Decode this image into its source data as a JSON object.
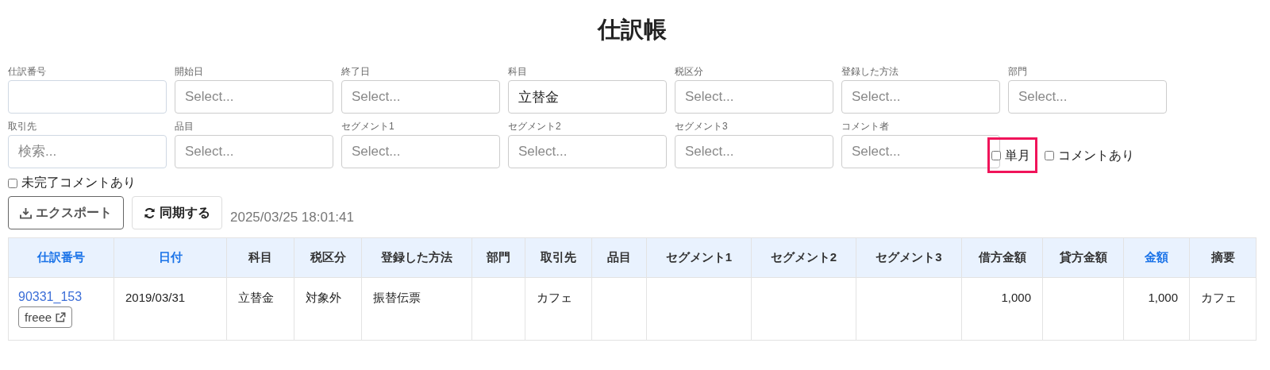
{
  "title": "仕訳帳",
  "filter_rows": [
    [
      {
        "label": "仕訳番号",
        "kind": "text"
      },
      {
        "label": "開始日",
        "kind": "select",
        "placeholder": "Select..."
      },
      {
        "label": "終了日",
        "kind": "select",
        "placeholder": "Select..."
      },
      {
        "label": "科目",
        "kind": "select",
        "value": "立替金"
      },
      {
        "label": "税区分",
        "kind": "select",
        "placeholder": "Select..."
      },
      {
        "label": "登録した方法",
        "kind": "select",
        "placeholder": "Select..."
      },
      {
        "label": "部門",
        "kind": "select",
        "placeholder": "Select..."
      }
    ],
    [
      {
        "label": "取引先",
        "kind": "text",
        "placeholder": "検索..."
      },
      {
        "label": "品目",
        "kind": "select",
        "placeholder": "Select..."
      },
      {
        "label": "セグメント1",
        "kind": "select",
        "placeholder": "Select..."
      },
      {
        "label": "セグメント2",
        "kind": "select",
        "placeholder": "Select..."
      },
      {
        "label": "セグメント3",
        "kind": "select",
        "placeholder": "Select..."
      },
      {
        "label": "コメント者",
        "kind": "select",
        "placeholder": "Select..."
      }
    ]
  ],
  "inline_checkboxes": [
    {
      "label": "単月",
      "checked": false,
      "highlighted": true
    },
    {
      "label": "コメントあり",
      "checked": false,
      "highlighted": false
    }
  ],
  "checkboxes": [
    {
      "label": "未完了コメントあり",
      "checked": false
    }
  ],
  "buttons": [
    {
      "label": "エクスポート",
      "kind": "export"
    },
    {
      "label": "同期する",
      "kind": "sync"
    }
  ],
  "last_synced": "2025/03/25 18:01:41",
  "table": {
    "columns": [
      {
        "label": "仕訳番号",
        "sortable": true
      },
      {
        "label": "日付",
        "sortable": true
      },
      {
        "label": "科目",
        "sortable": false
      },
      {
        "label": "税区分",
        "sortable": false
      },
      {
        "label": "登録した方法",
        "sortable": false
      },
      {
        "label": "部門",
        "sortable": false
      },
      {
        "label": "取引先",
        "sortable": false
      },
      {
        "label": "品目",
        "sortable": false
      },
      {
        "label": "セグメント1",
        "sortable": false
      },
      {
        "label": "セグメント2",
        "sortable": false
      },
      {
        "label": "セグメント3",
        "sortable": false
      },
      {
        "label": "借方金額",
        "sortable": false
      },
      {
        "label": "貸方金額",
        "sortable": false
      },
      {
        "label": "金額",
        "sortable": true
      },
      {
        "label": "摘要",
        "sortable": false
      }
    ],
    "rows": [
      {
        "cells": [
          {
            "link": "90331_153",
            "external_button": "freee"
          },
          "2019/03/31",
          "立替金",
          "対象外",
          "振替伝票",
          "",
          "カフェ",
          "",
          "",
          "",
          "",
          "1,000",
          "",
          "1,000",
          "カフェ"
        ]
      }
    ]
  }
}
